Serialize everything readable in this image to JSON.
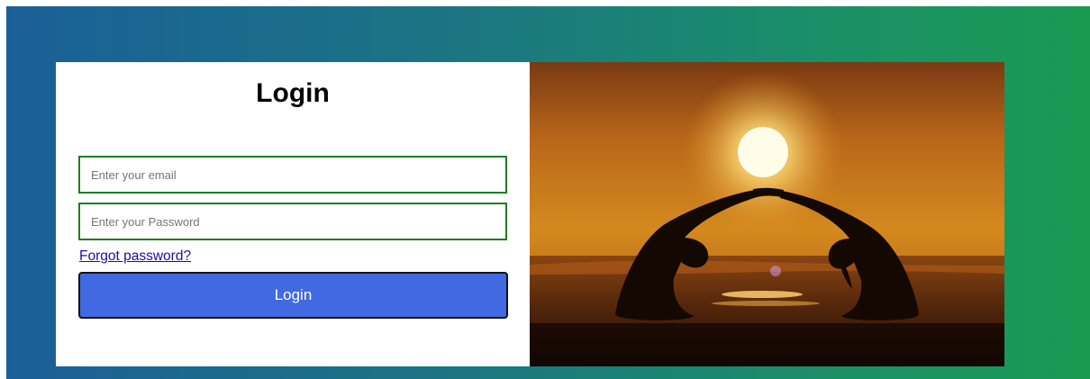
{
  "login_form": {
    "title": "Login",
    "email_placeholder": "Enter your email",
    "password_placeholder": "Enter your Password",
    "forgot_password_link": "Forgot password?",
    "submit_label": "Login"
  },
  "hero_image": {
    "alt": "Two people doing yoga backbends on a beach at sunset"
  },
  "colors": {
    "background_gradient_start": "#1b5f98",
    "background_gradient_end": "#199a52",
    "input_border": "#1c7f1c",
    "button_bg": "#4169e1",
    "link": "#1a0dab"
  }
}
